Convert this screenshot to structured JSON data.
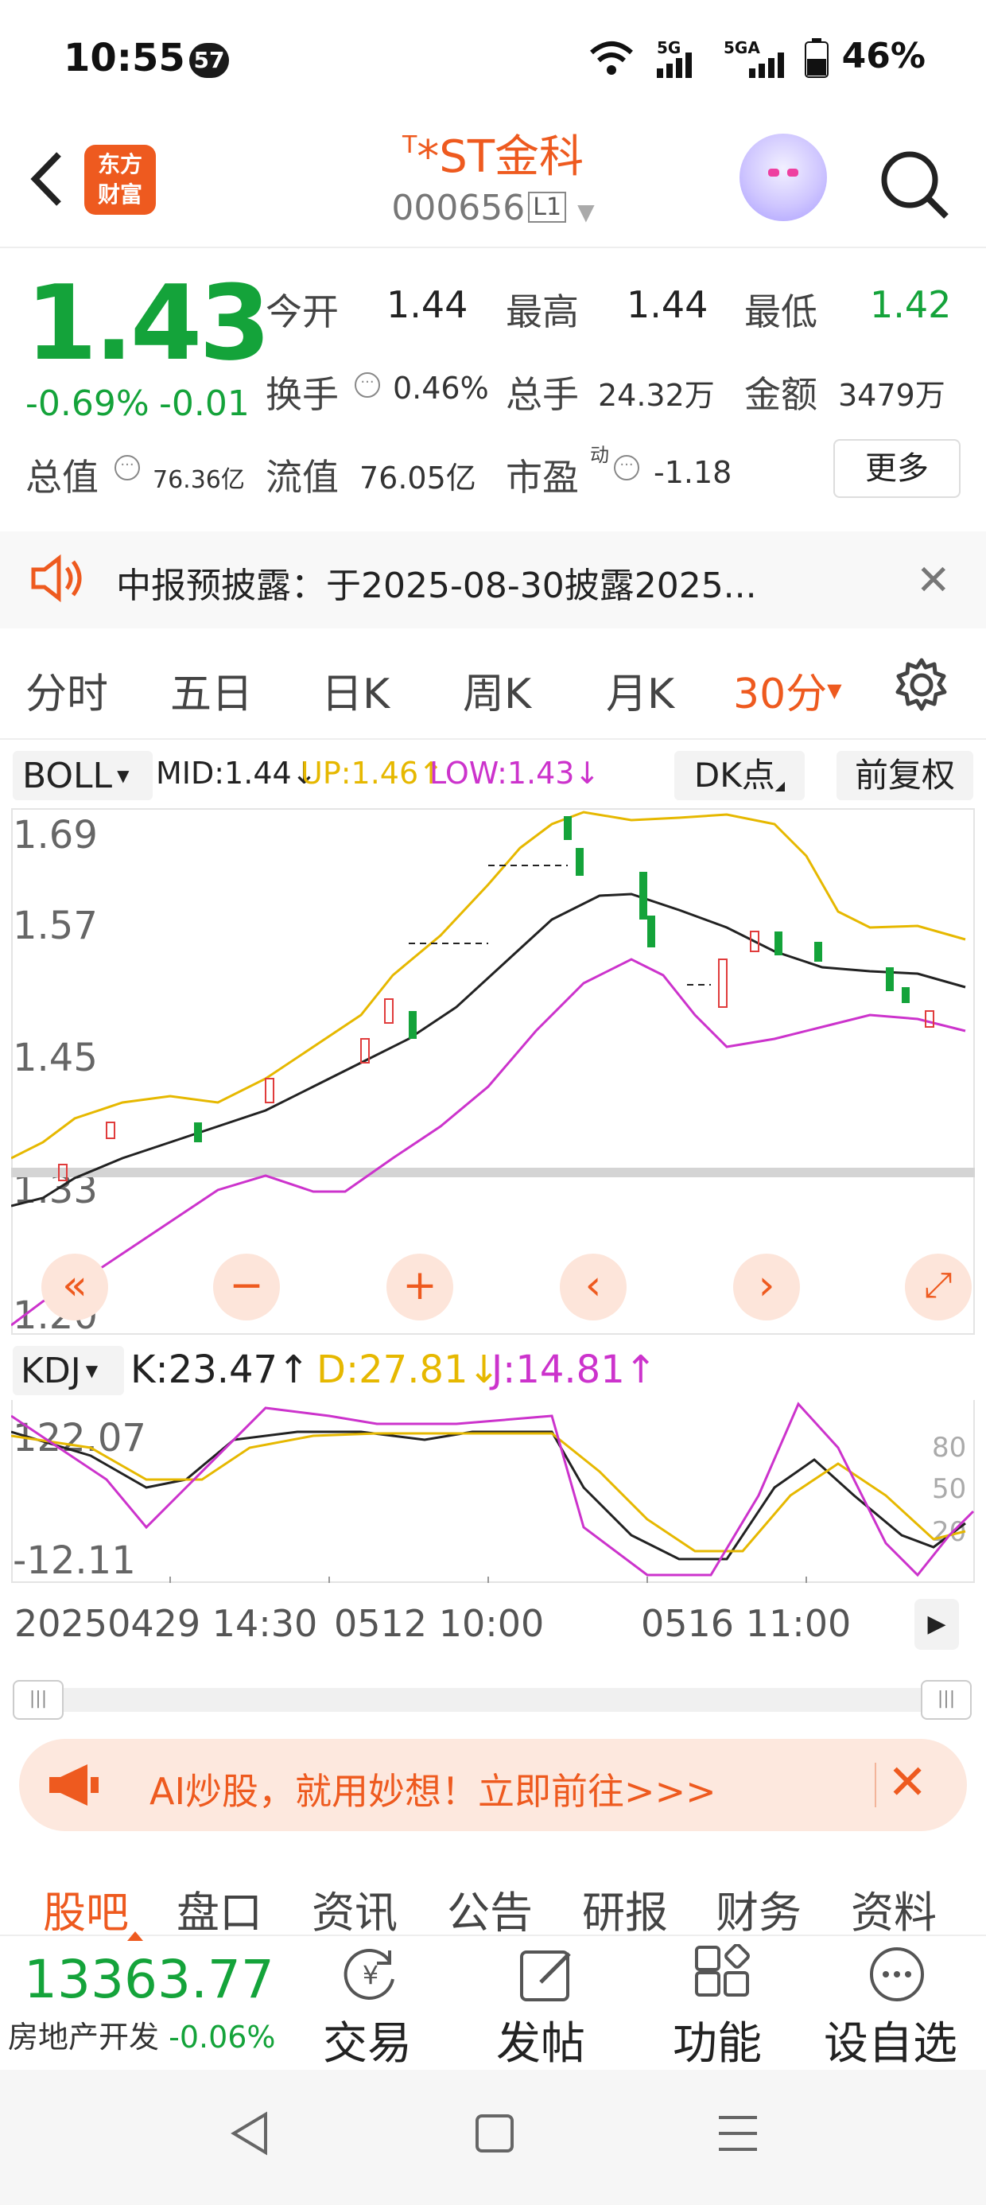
{
  "status": {
    "time": "10:55",
    "badge": "57",
    "battery": "46%",
    "sig1": "5G",
    "sig2": "5GA"
  },
  "header": {
    "logo_line1": "东方",
    "logo_line2": "财富",
    "title_mark": "T",
    "title": "*ST金科",
    "code": "000656",
    "level": "L1"
  },
  "quote": {
    "price": "1.43",
    "change_pct": "-0.69%",
    "change_abs": "-0.01",
    "open_label": "今开",
    "open": "1.44",
    "high_label": "最高",
    "high": "1.44",
    "low_label": "最低",
    "low": "1.42",
    "turnover_label": "换手",
    "turnover": "0.46%",
    "volume_label": "总手",
    "volume": "24.32万",
    "amount_label": "金额",
    "amount": "3479万",
    "mktcap_label": "总值",
    "mktcap": "76.36亿",
    "float_label": "流值",
    "float_cap": "76.05亿",
    "pe_label": "市盈",
    "pe_sup": "动",
    "pe": "-1.18",
    "more": "更多"
  },
  "notice": {
    "text": "中报预披露：于2025-08-30披露2025..."
  },
  "period_tabs": [
    "分时",
    "五日",
    "日K",
    "周K",
    "月K",
    "30分"
  ],
  "boll": {
    "name": "BOLL",
    "mid": "MID:1.44↓",
    "up": "UP:1.46↑",
    "low": "LOW:1.43↓",
    "dk": "DK点",
    "adjust": "前复权",
    "colors": {
      "mid": "#222222",
      "up": "#e6b800",
      "low": "#cc33cc"
    }
  },
  "price_axis": [
    "1.69",
    "1.57",
    "1.45",
    "1.33",
    "1.20"
  ],
  "kdj": {
    "name": "KDJ",
    "k": "K:23.47↑",
    "d": "D:27.81↓",
    "j": "J:14.81↑",
    "axis_top": "122.07",
    "axis_bottom": "-12.11",
    "levels": [
      "80",
      "50",
      "20"
    ]
  },
  "dates": {
    "left": "20250429 14:30",
    "mid": "0512 10:00",
    "right": "0516 11:00"
  },
  "chart_controls": [
    "«",
    "−",
    "+",
    "‹",
    "›",
    "⤢"
  ],
  "ai_banner": {
    "text": "AI炒股，就用妙想！立即前往>>>"
  },
  "bottom_tabs": [
    "股吧",
    "盘口",
    "资讯",
    "公告",
    "研报",
    "财务",
    "资料"
  ],
  "index": {
    "value": "13363.77",
    "name": "房地产开发",
    "change": "-0.06%"
  },
  "actions": [
    "交易",
    "发帖",
    "功能",
    "设自选"
  ],
  "icons": [
    "back-icon",
    "search-icon",
    "speaker-icon",
    "close-icon",
    "gear-icon",
    "yen-cycle-icon",
    "edit-icon",
    "grid-icon",
    "more-icon"
  ],
  "colors": {
    "accent": "#ee5a1f",
    "down_green": "#14a33a",
    "up_red": "#e03c3c"
  }
}
